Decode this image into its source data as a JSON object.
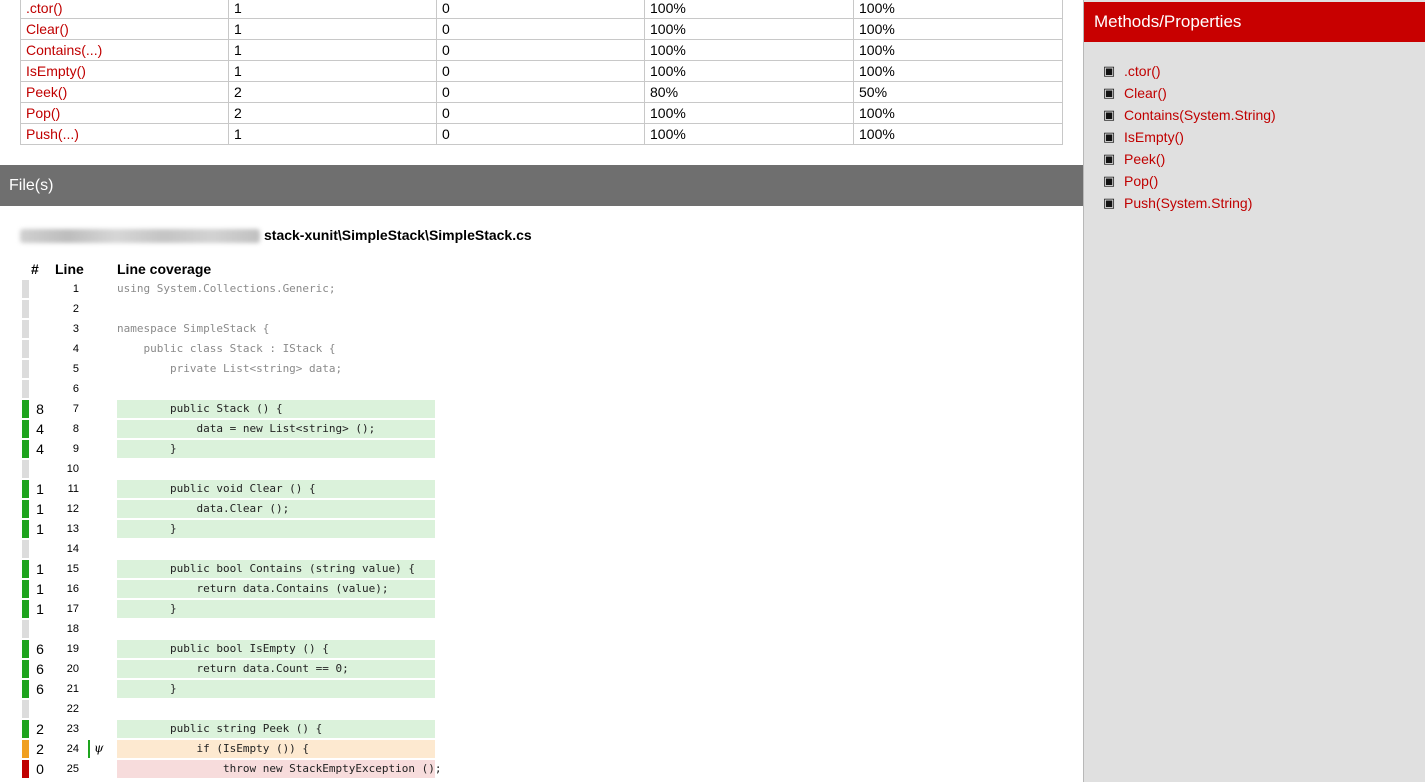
{
  "metrics": {
    "rows": [
      {
        "name": ".ctor()",
        "c1": "1",
        "c2": "0",
        "c3": "100%",
        "c4": "100%"
      },
      {
        "name": "Clear()",
        "c1": "1",
        "c2": "0",
        "c3": "100%",
        "c4": "100%"
      },
      {
        "name": "Contains(...)",
        "c1": "1",
        "c2": "0",
        "c3": "100%",
        "c4": "100%"
      },
      {
        "name": "IsEmpty()",
        "c1": "1",
        "c2": "0",
        "c3": "100%",
        "c4": "100%"
      },
      {
        "name": "Peek()",
        "c1": "2",
        "c2": "0",
        "c3": "80%",
        "c4": "50%"
      },
      {
        "name": "Pop()",
        "c1": "2",
        "c2": "0",
        "c3": "100%",
        "c4": "100%"
      },
      {
        "name": "Push(...)",
        "c1": "1",
        "c2": "0",
        "c3": "100%",
        "c4": "100%"
      }
    ]
  },
  "files": {
    "header": "File(s)",
    "path": "stack-xunit\\SimpleStack\\SimpleStack.cs",
    "columns": {
      "hash": "#",
      "line": "Line",
      "coverage": "Line coverage"
    },
    "lines": [
      {
        "num": "1",
        "hits": "",
        "status": "none",
        "code": "using System.Collections.Generic;"
      },
      {
        "num": "2",
        "hits": "",
        "status": "none",
        "code": ""
      },
      {
        "num": "3",
        "hits": "",
        "status": "none",
        "code": "namespace SimpleStack {"
      },
      {
        "num": "4",
        "hits": "",
        "status": "none",
        "code": "    public class Stack : IStack {"
      },
      {
        "num": "5",
        "hits": "",
        "status": "none",
        "code": "        private List<string> data;"
      },
      {
        "num": "6",
        "hits": "",
        "status": "none",
        "code": ""
      },
      {
        "num": "7",
        "hits": "8",
        "status": "covered",
        "code": "        public Stack () {"
      },
      {
        "num": "8",
        "hits": "4",
        "status": "covered",
        "code": "            data = new List<string> ();"
      },
      {
        "num": "9",
        "hits": "4",
        "status": "covered",
        "code": "        }"
      },
      {
        "num": "10",
        "hits": "",
        "status": "none",
        "code": ""
      },
      {
        "num": "11",
        "hits": "1",
        "status": "covered",
        "code": "        public void Clear () {"
      },
      {
        "num": "12",
        "hits": "1",
        "status": "covered",
        "code": "            data.Clear ();"
      },
      {
        "num": "13",
        "hits": "1",
        "status": "covered",
        "code": "        }"
      },
      {
        "num": "14",
        "hits": "",
        "status": "none",
        "code": ""
      },
      {
        "num": "15",
        "hits": "1",
        "status": "covered",
        "code": "        public bool Contains (string value) {"
      },
      {
        "num": "16",
        "hits": "1",
        "status": "covered",
        "code": "            return data.Contains (value);"
      },
      {
        "num": "17",
        "hits": "1",
        "status": "covered",
        "code": "        }"
      },
      {
        "num": "18",
        "hits": "",
        "status": "none",
        "code": ""
      },
      {
        "num": "19",
        "hits": "6",
        "status": "covered",
        "code": "        public bool IsEmpty () {"
      },
      {
        "num": "20",
        "hits": "6",
        "status": "covered",
        "code": "            return data.Count == 0;"
      },
      {
        "num": "21",
        "hits": "6",
        "status": "covered",
        "code": "        }"
      },
      {
        "num": "22",
        "hits": "",
        "status": "none",
        "code": ""
      },
      {
        "num": "23",
        "hits": "2",
        "status": "covered",
        "code": "        public string Peek () {"
      },
      {
        "num": "24",
        "hits": "2",
        "status": "partial",
        "code": "            if (IsEmpty ()) {",
        "branch": "ψ"
      },
      {
        "num": "25",
        "hits": "0",
        "status": "uncovered",
        "code": "                throw new StackEmptyException ();"
      }
    ]
  },
  "sidebar": {
    "title": "Methods/Properties",
    "icon": "cube-icon",
    "items": [
      ".ctor()",
      "Clear()",
      "Contains(System.String)",
      "IsEmpty()",
      "Peek()",
      "Pop()",
      "Push(System.String)"
    ]
  },
  "colors": {
    "accent": "#c80000",
    "link": "#c00000",
    "covered": "#1ea41e",
    "partial": "#f0a020",
    "uncovered": "#c00000",
    "header_gray": "#6f6f6f",
    "sidebar_bg": "#e0e0e0"
  }
}
